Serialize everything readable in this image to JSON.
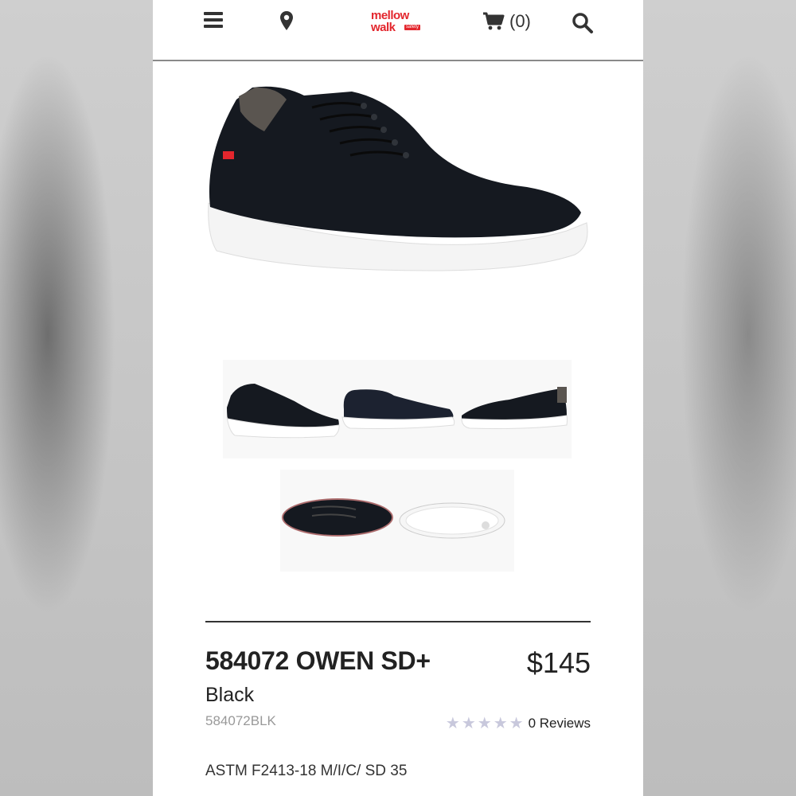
{
  "header": {
    "logo_line1": "mellow",
    "logo_line2": "walk",
    "logo_tag": "safety",
    "cart_count": "(0)",
    "icons": [
      "menu-icon",
      "location-pin-icon",
      "cart-icon",
      "search-icon"
    ]
  },
  "colors": {
    "brand_red": "#e3262d",
    "text_dark": "#222222",
    "sku_gray": "#999999",
    "star_gray": "#c8c8dc"
  },
  "product": {
    "title": "584072 OWEN SD+",
    "price": "$145",
    "color": "Black",
    "sku": "584072BLK",
    "rating_stars": 0,
    "star_glyphs": "★★★★★",
    "reviews": "0 Reviews",
    "spec": "ASTM F2413-18 M/I/C/ SD 35"
  }
}
